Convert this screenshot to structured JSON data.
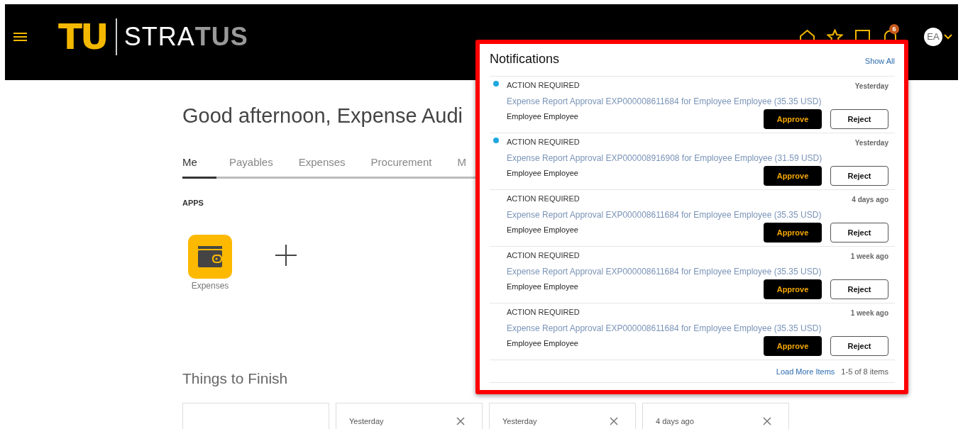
{
  "header": {
    "logo_mark": "TU",
    "wordmark_parts": [
      "STRA",
      "TUS"
    ],
    "notification_count": "6",
    "avatar_initials": "EA"
  },
  "greeting": "Good afternoon, Expense Audi",
  "tabs": [
    {
      "label": "Me",
      "selected": true
    },
    {
      "label": "Payables",
      "selected": false
    },
    {
      "label": "Expenses",
      "selected": false
    },
    {
      "label": "Procurement",
      "selected": false
    },
    {
      "label": "M",
      "selected": false
    }
  ],
  "apps": {
    "heading": "APPS",
    "items": [
      {
        "label": "Expenses"
      }
    ]
  },
  "things_to_finish": {
    "heading": "Things to Finish",
    "cards": [
      {
        "kind": "blank"
      },
      {
        "kind": "task",
        "time": "Yesterday"
      },
      {
        "kind": "task",
        "time": "Yesterday"
      },
      {
        "kind": "task",
        "time": "4 days ago"
      }
    ]
  },
  "notifications": {
    "title": "Notifications",
    "show_all": "Show All",
    "items": [
      {
        "unread": true,
        "label": "ACTION REQUIRED",
        "time": "Yesterday",
        "title": "Expense Report Approval EXP000008611684 for Employee Employee (35.35 USD)",
        "sender": "Employee Employee",
        "buttons": [
          "Approve",
          "Reject"
        ]
      },
      {
        "unread": true,
        "label": "ACTION REQUIRED",
        "time": "Yesterday",
        "title": "Expense Report Approval EXP000008916908 for Employee Employee (31.59 USD)",
        "sender": "Employee Employee",
        "buttons": [
          "Approve",
          "Reject"
        ]
      },
      {
        "unread": false,
        "label": "ACTION REQUIRED",
        "time": "4 days ago",
        "title": "Expense Report Approval EXP000008611684 for Employee Employee (35.35 USD)",
        "sender": "Employee Employee",
        "buttons": [
          "Approve",
          "Reject"
        ]
      },
      {
        "unread": false,
        "label": "ACTION REQUIRED",
        "time": "1 week ago",
        "title": "Expense Report Approval EXP000008611684 for Employee Employee (35.35 USD)",
        "sender": "Employee Employee",
        "buttons": [
          "Approve",
          "Reject"
        ]
      },
      {
        "unread": false,
        "label": "ACTION REQUIRED",
        "time": "1 week ago",
        "title": "Expense Report Approval EXP000008611684 for Employee Employee (35.35 USD)",
        "sender": "Employee Employee",
        "buttons": [
          "Approve",
          "Reject"
        ]
      }
    ],
    "load_more": "Load More Items",
    "range": "1-5 of 8 items"
  }
}
